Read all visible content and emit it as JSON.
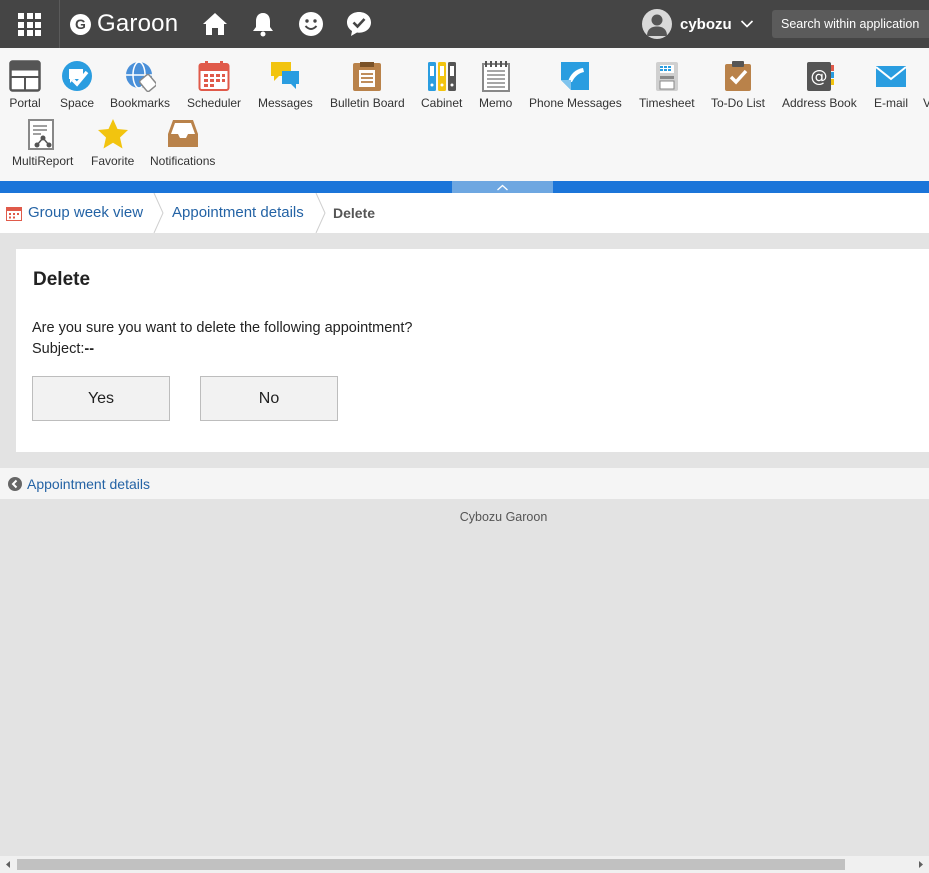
{
  "header": {
    "brand": "Garoon",
    "brand_initial": "G",
    "user_name": "cybozu",
    "search_placeholder": "Search within application"
  },
  "apps": [
    {
      "label": "Portal",
      "icon": "portal-icon"
    },
    {
      "label": "Space",
      "icon": "space-icon"
    },
    {
      "label": "Bookmarks",
      "icon": "bookmarks-icon"
    },
    {
      "label": "Scheduler",
      "icon": "scheduler-icon"
    },
    {
      "label": "Messages",
      "icon": "messages-icon"
    },
    {
      "label": "Bulletin Board",
      "icon": "bulletin-board-icon"
    },
    {
      "label": "Cabinet",
      "icon": "cabinet-icon"
    },
    {
      "label": "Memo",
      "icon": "memo-icon"
    },
    {
      "label": "Phone Messages",
      "icon": "phone-messages-icon"
    },
    {
      "label": "Timesheet",
      "icon": "timesheet-icon"
    },
    {
      "label": "To-Do List",
      "icon": "todo-list-icon"
    },
    {
      "label": "Address Book",
      "icon": "address-book-icon"
    },
    {
      "label": "E-mail",
      "icon": "email-icon"
    },
    {
      "label": "V",
      "icon": "truncated-app-icon"
    },
    {
      "label": "MultiReport",
      "icon": "multireport-icon"
    },
    {
      "label": "Favorite",
      "icon": "favorite-icon"
    },
    {
      "label": "Notifications",
      "icon": "notifications-icon"
    }
  ],
  "breadcrumb": {
    "items": [
      "Group week view",
      "Appointment details",
      "Delete"
    ]
  },
  "dialog": {
    "title": "Delete",
    "message": "Are you sure you want to delete the following appointment?",
    "subject_label": "Subject:",
    "subject_value": "--",
    "yes_label": "Yes",
    "no_label": "No"
  },
  "back_link": "Appointment details",
  "footer": "Cybozu Garoon",
  "colors": {
    "header_bg": "#454545",
    "accent_blue": "#1b75d9",
    "link": "#2463a5",
    "page_bg": "#e3e3e3"
  }
}
